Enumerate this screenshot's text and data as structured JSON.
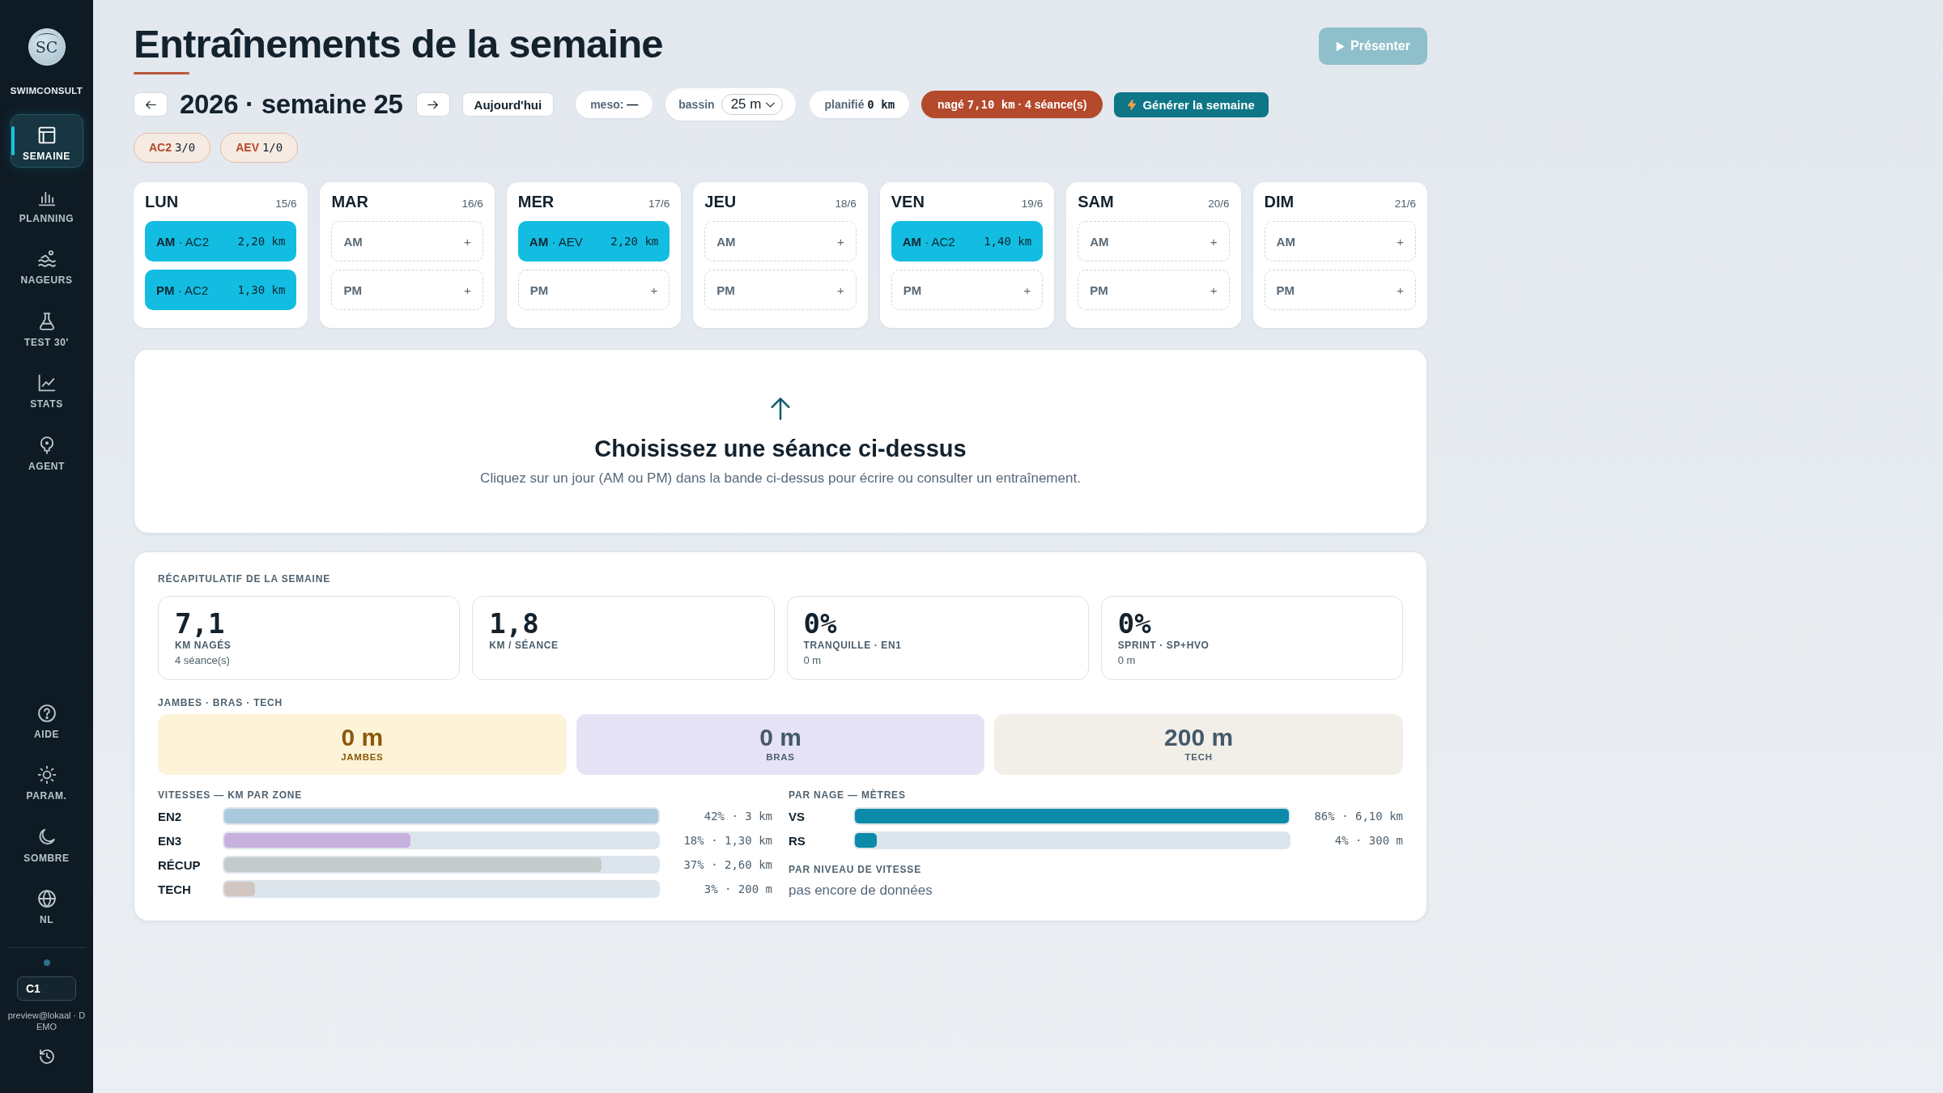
{
  "sidebar": {
    "brand": {
      "logo": "SC",
      "name": "SWIMCONSULT"
    },
    "nav": [
      {
        "label": "SEMAINE",
        "selected": true
      },
      {
        "label": "PLANNING",
        "selected": false
      },
      {
        "label": "NAGEURS",
        "selected": false
      },
      {
        "label": "TEST 30′",
        "selected": false
      },
      {
        "label": "STATS",
        "selected": false
      },
      {
        "label": "AGENT",
        "selected": false
      }
    ],
    "tools": [
      {
        "label": "AIDE"
      },
      {
        "label": "PARAM."
      },
      {
        "label": "SOMBRE"
      },
      {
        "label": "NL"
      }
    ],
    "account": {
      "code": "C1",
      "email": "preview@lokaal · DEMO"
    }
  },
  "header": {
    "title": "Entraînements de la semaine",
    "present_button": "Présenter",
    "week_label": "2026 · semaine 25",
    "today_button": "Aujourd'hui",
    "meso": {
      "label": "meso:",
      "value": "—"
    },
    "pool": {
      "label": "bassin",
      "value": "25 m"
    },
    "planned": {
      "label": "planifié",
      "value": "0 km"
    },
    "swum": {
      "label": "nagé",
      "value": "7,10 km",
      "sessions": "· 4 séance(s)"
    },
    "generate_button": "Générer la semaine",
    "zone_tags": [
      {
        "zone": "AC2",
        "count": "3/0"
      },
      {
        "zone": "AEV",
        "count": "1/0"
      }
    ]
  },
  "days": [
    {
      "name": "LUN",
      "date": "15/6",
      "slots": [
        {
          "kind": "session",
          "label": "**AM** · AC2",
          "distance": "2,20 km"
        },
        {
          "kind": "session",
          "label": "**PM** · AC2",
          "distance": "1,30 km"
        }
      ]
    },
    {
      "name": "MAR",
      "date": "16/6",
      "slots": [
        {
          "kind": "empty",
          "label": "AM",
          "add": "+"
        },
        {
          "kind": "empty",
          "label": "PM",
          "add": "+"
        }
      ]
    },
    {
      "name": "MER",
      "date": "17/6",
      "slots": [
        {
          "kind": "session",
          "label": "**AM** · AEV",
          "distance": "2,20 km"
        },
        {
          "kind": "empty",
          "label": "PM",
          "add": "+"
        }
      ]
    },
    {
      "name": "JEU",
      "date": "18/6",
      "slots": [
        {
          "kind": "empty",
          "label": "AM",
          "add": "+"
        },
        {
          "kind": "empty",
          "label": "PM",
          "add": "+"
        }
      ]
    },
    {
      "name": "VEN",
      "date": "19/6",
      "slots": [
        {
          "kind": "session",
          "label": "**AM** · AC2",
          "distance": "1,40 km"
        },
        {
          "kind": "empty",
          "label": "PM",
          "add": "+"
        }
      ]
    },
    {
      "name": "SAM",
      "date": "20/6",
      "slots": [
        {
          "kind": "empty",
          "label": "AM",
          "add": "+"
        },
        {
          "kind": "empty",
          "label": "PM",
          "add": "+"
        }
      ]
    },
    {
      "name": "DIM",
      "date": "21/6",
      "slots": [
        {
          "kind": "empty",
          "label": "AM",
          "add": "+"
        },
        {
          "kind": "empty",
          "label": "PM",
          "add": "+"
        }
      ]
    }
  ],
  "empty_state": {
    "title": "Choisissez une séance ci-dessus",
    "text": "Cliquez sur un jour (AM ou PM) dans la bande ci-dessus pour écrire ou consulter un entraînement."
  },
  "summary": {
    "title": "RÉCAPITULATIF DE LA SEMAINE",
    "stats": [
      {
        "value": "7,1",
        "label": "KM NAGÉS",
        "note": "4 séance(s)"
      },
      {
        "value": "1,8",
        "label": "KM / SÉANCE"
      },
      {
        "value": "0%",
        "label": "TRANQUILLE · EN1",
        "note": "0 m"
      },
      {
        "value": "0%",
        "label": "SPRINT · SP+HVO",
        "note": "0 m"
      }
    ],
    "drills_title": "JAMBES · BRAS · TECH",
    "drills": [
      {
        "value": "0 m",
        "label": "JAMBES",
        "color": "#fdf3d8"
      },
      {
        "value": "0 m",
        "label": "BRAS",
        "color": "#e6e3f6"
      },
      {
        "value": "200 m",
        "label": "TECH",
        "color": "#f2efe9"
      }
    ],
    "speeds": {
      "title": "VITESSES — KM PAR ZONE",
      "rows": [
        {
          "zone": "EN2",
          "level": 1,
          "reading": "42% · 3 km",
          "color": "#a9c9dd"
        },
        {
          "zone": "EN3",
          "level": 0.43,
          "reading": "18% · 1,30 km",
          "color": "#c7b0dd"
        },
        {
          "zone": "RÉCUP",
          "level": 0.87,
          "reading": "37% · 2,60 km",
          "color": "#c3cccb"
        },
        {
          "zone": "TECH",
          "level": 0.07,
          "reading": "3% · 200 m",
          "color": "#d2c6c1"
        }
      ]
    },
    "strokes": {
      "title": "PAR NAGE — MÈTRES",
      "rows": [
        {
          "stroke": "VS",
          "level": 1,
          "reading": "86% · 6,10 km"
        },
        {
          "stroke": "RS",
          "level": 0.05,
          "reading": "4% · 300 m"
        }
      ]
    },
    "speed_levels": {
      "title": "PAR NIVEAU DE VITESSE",
      "empty_text": "pas encore de données"
    }
  }
}
